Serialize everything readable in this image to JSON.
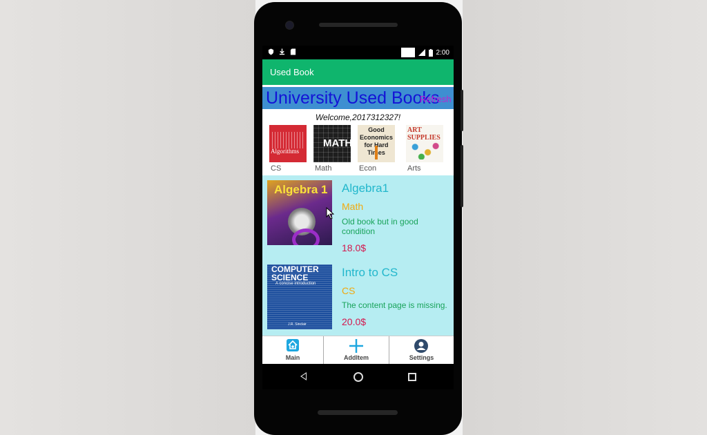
{
  "status_bar": {
    "time": "2:00"
  },
  "app_bar": {
    "title": "Used Book"
  },
  "banner": {
    "title": "University Used Books",
    "link": "Refresh"
  },
  "welcome_text": "Welcome,2017312327!",
  "categories": [
    {
      "label": "CS",
      "cover_text": "Algorithms"
    },
    {
      "label": "Math",
      "cover_text": "MATH"
    },
    {
      "label": "Econ",
      "cover_text": "Good Economics for Hard Times"
    },
    {
      "label": "Arts",
      "cover_text": "ART SUPPLIES"
    }
  ],
  "books": [
    {
      "title": "Algebra1",
      "category": "Math",
      "description": "Old book but in good condition",
      "price": "18.0$",
      "cover_text": "Algebra 1"
    },
    {
      "title": "Intro to CS",
      "category": "CS",
      "description": "The content page is missing.",
      "price": "20.0$",
      "cover_text": "COMPUTER SCIENCE",
      "cover_sub": "A concise introduction",
      "cover_author": "J.R. Sinclair"
    }
  ],
  "bottom_nav": [
    {
      "label": "Main",
      "icon": "home-icon"
    },
    {
      "label": "AddItem",
      "icon": "plus-icon"
    },
    {
      "label": "Settings",
      "icon": "person-icon"
    }
  ],
  "colors": {
    "app_bar": "#0fb56d",
    "banner_bg": "#3e8fd1",
    "banner_text": "#1313d6",
    "list_bg": "#b6edf2",
    "title": "#22b7cc",
    "category": "#f1a90e",
    "description": "#19a35a",
    "price": "#d4174d"
  }
}
